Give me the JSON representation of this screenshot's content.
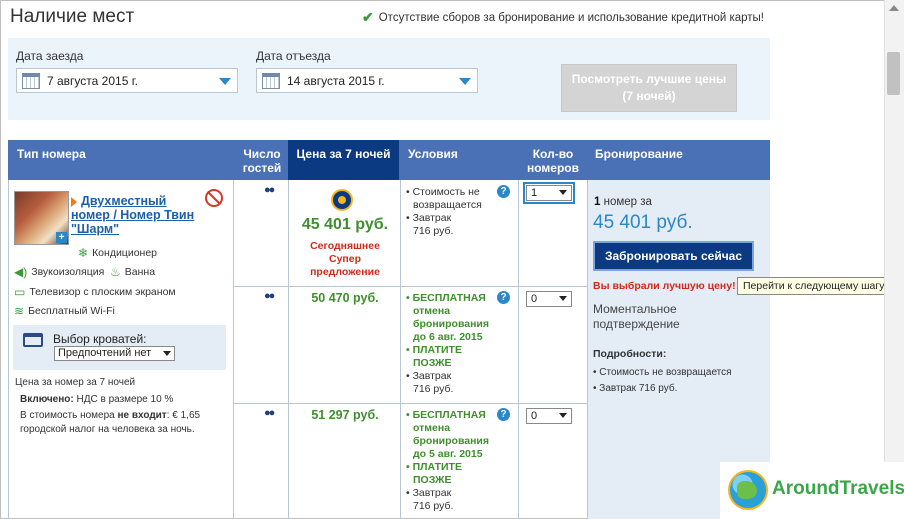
{
  "page": {
    "title": "Наличие мест",
    "no_fees": "Отсутствие сборов за бронирование и использование кредитной карты!"
  },
  "dates": {
    "checkin_label": "Дата заезда",
    "checkin_value": "7 августа 2015 г.",
    "checkout_label": "Дата отъезда",
    "checkout_value": "14 августа 2015 г.",
    "best_prices_line1": "Посмотреть лучшие цены",
    "best_prices_line2": "(7 ночей)"
  },
  "table": {
    "headers": {
      "room_type": "Тип номера",
      "guests_1": "Число",
      "guests_2": "гостей",
      "price": "Цена за 7 ночей",
      "conditions": "Условия",
      "qty_1": "Кол-во",
      "qty_2": "номеров",
      "booking": "Бронирование"
    }
  },
  "room": {
    "name_line1": "Двухместный",
    "name_line2": "номер / Номер Твин",
    "name_line3": "\"Шарм\"",
    "amenities": {
      "ac": "Кондиционер",
      "soundproof": "Звукоизоляция",
      "bath": "Ванна",
      "tv": "Телевизор с плоским экраном",
      "wifi": "Бесплатный Wi-Fi"
    },
    "bed_label": "Выбор кроватей:",
    "bed_value": "Предпочтений нет",
    "price_note": "Цена за номер за 7 ночей",
    "included_label": "Включено:",
    "included_value": "НДС в размере 10 %",
    "excluded_pre": "В стоимость номера",
    "excluded_bold": "не входит",
    "excluded_line1_tail": ": € 1,65",
    "excluded_line2": "городской налог на человека за ночь."
  },
  "rates": [
    {
      "price": "45 401 руб.",
      "deal_line1": "Сегодняшнее",
      "deal_line2": "Супер",
      "deal_line3": "предложение",
      "cond_1": "• Стоимость не",
      "cond_2": "возвращается",
      "cond_3": "• Завтрак",
      "cond_4": "716 руб.",
      "qty": "1"
    },
    {
      "price": "50 470 руб.",
      "cond_1": "• БЕСПЛАТНАЯ",
      "cond_2": "отмена",
      "cond_3": "бронирования",
      "cond_4": "до 6 авг. 2015",
      "cond_5": "• ПЛАТИТЕ",
      "cond_6": "ПОЗЖЕ",
      "cond_7": "• Завтрак",
      "cond_8": "716 руб.",
      "qty": "0"
    },
    {
      "price": "51 297 руб.",
      "cond_1": "• БЕСПЛАТНАЯ",
      "cond_2": "отмена",
      "cond_3": "бронирования",
      "cond_4": "до 5 авг. 2015",
      "cond_5": "• ПЛАТИТЕ",
      "cond_6": "ПОЗЖЕ",
      "cond_7": "• Завтрак",
      "cond_8": "716 руб.",
      "qty": "0"
    }
  ],
  "booking": {
    "count_num": "1",
    "count_text": "номер за",
    "total": "45 401 руб.",
    "book_button": "Забронировать сейчас",
    "best_choice": "Вы выбрали лучшую цену!",
    "instant_line1": "Моментальное",
    "instant_line2": "подтверждение",
    "details_label": "Подробности:",
    "detail_1": "• Стоимость не возвращается",
    "detail_2": "• Завтрак 716 руб."
  },
  "tooltip": "Перейти к следующему шагу",
  "watermark": "AroundTravels",
  "colors": {
    "header_blue": "#4a70b6",
    "price_header": "#0b3a82",
    "price_green": "#3f8f2e",
    "deal_red": "#d12a1a",
    "link_blue": "#1d5ea8"
  }
}
